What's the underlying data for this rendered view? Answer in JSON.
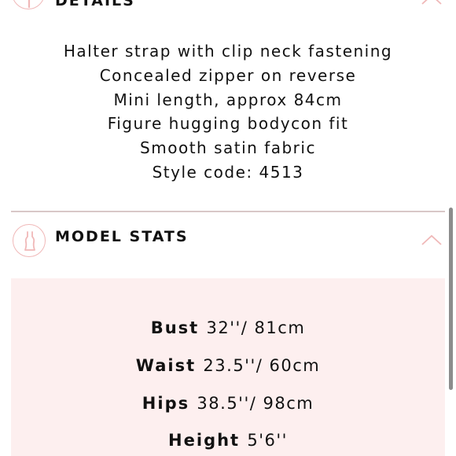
{
  "details": {
    "title": "DETAILS",
    "icon": "dress-icon",
    "lines": [
      "Halter strap with clip neck fastening",
      "Concealed zipper on reverse",
      "Mini length, approx 84cm",
      "Figure hugging bodycon fit",
      "Smooth satin fabric",
      "Style code: 4513"
    ]
  },
  "model_stats": {
    "title": "MODEL STATS",
    "icon": "mannequin-icon",
    "stats": [
      {
        "label": "Bust",
        "value": "32''/ 81cm"
      },
      {
        "label": "Waist",
        "value": "23.5''/ 60cm"
      },
      {
        "label": "Hips",
        "value": "38.5''/ 98cm"
      },
      {
        "label": "Height",
        "value": "5'6''"
      }
    ]
  },
  "colors": {
    "accent_pink": "#f0b8b8",
    "panel_background": "#fdefef",
    "divider": "#d9c8c8",
    "text": "#111111"
  }
}
